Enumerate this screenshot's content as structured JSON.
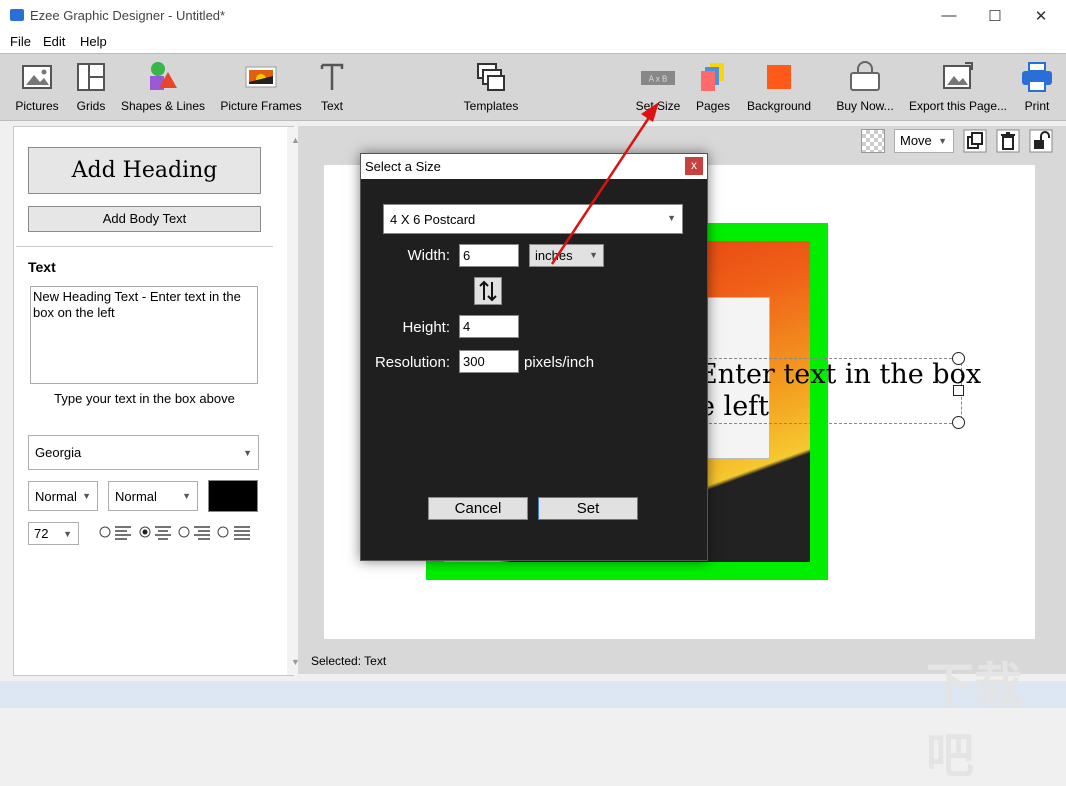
{
  "window": {
    "title": "Ezee Graphic Designer - Untitled*"
  },
  "menu": [
    "File",
    "Edit",
    "Help"
  ],
  "toolbar": {
    "pictures": "Pictures",
    "grids": "Grids",
    "shapes": "Shapes & Lines",
    "frames": "Picture Frames",
    "text": "Text",
    "templates": "Templates",
    "set_size": "Set Size",
    "pages": "Pages",
    "background": "Background",
    "buy": "Buy Now...",
    "export": "Export this Page...",
    "print": "Print"
  },
  "left_panel": {
    "add_heading": "Add Heading",
    "add_body": "Add Body Text",
    "text_header": "Text",
    "text_value": "New Heading Text - Enter text in the box on the left",
    "hint": "Type your text in the box above",
    "font": "Georgia",
    "style1": "Normal",
    "style2": "Normal",
    "font_color": "#000000",
    "size": "72"
  },
  "canvas": {
    "move_mode": "Move",
    "text_line1": "Enter text in the box",
    "text_line2": "e left",
    "frame_color": "#00ee00",
    "status": "Selected: Text"
  },
  "dialog": {
    "title": "Select a Size",
    "close": "x",
    "preset": "4 X 6 Postcard",
    "width_label": "Width:",
    "width_value": "6",
    "unit": "inches",
    "height_label": "Height:",
    "height_value": "4",
    "resolution_label": "Resolution:",
    "resolution_value": "300",
    "resolution_unit": "pixels/inch",
    "cancel": "Cancel",
    "set": "Set"
  },
  "watermark": "下载吧"
}
